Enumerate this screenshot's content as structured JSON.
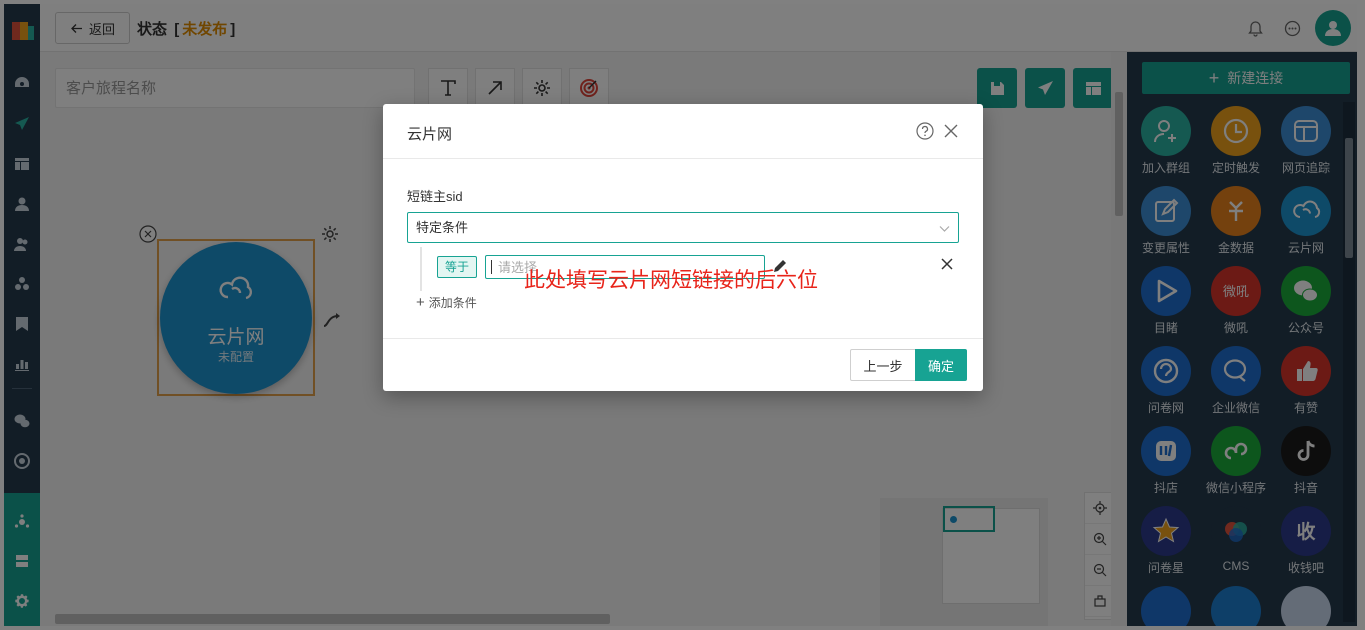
{
  "header": {
    "back_label": "返回",
    "title_prefix": "状态",
    "bracket_open": "[",
    "status": "未发布",
    "bracket_close": "]"
  },
  "canvas": {
    "name_placeholder": "客户旅程名称",
    "node": {
      "label": "云片网",
      "sublabel": "未配置"
    }
  },
  "right_panel": {
    "new_connection_label": "新建连接",
    "tiles": [
      {
        "label": "加入群组",
        "color": "#2bb3a3",
        "icon": "user-add-icon"
      },
      {
        "label": "定时触发",
        "color": "#f0a31c",
        "icon": "clock-icon"
      },
      {
        "label": "网页追踪",
        "color": "#3d8fd6",
        "icon": "webpage-icon"
      },
      {
        "label": "变更属性",
        "color": "#3d8fd6",
        "icon": "edit-icon"
      },
      {
        "label": "金数据",
        "color": "#e8831c",
        "icon": "jinshuju-icon"
      },
      {
        "label": "云片网",
        "color": "#1d94d1",
        "icon": "cloud-icon"
      },
      {
        "label": "目睹",
        "color": "#1f6fd1",
        "icon": "play-icon"
      },
      {
        "label": "微吼",
        "color": "#d9342b",
        "icon": "weihou-icon"
      },
      {
        "label": "公众号",
        "color": "#1aad3b",
        "icon": "wechat-icon"
      },
      {
        "label": "问卷网",
        "color": "#1f6fd1",
        "icon": "wenjuan-icon"
      },
      {
        "label": "企业微信",
        "color": "#1f6fd1",
        "icon": "wecom-icon"
      },
      {
        "label": "有赞",
        "color": "#d9342b",
        "icon": "thumb-up-icon"
      },
      {
        "label": "抖店",
        "color": "#1f6fd1",
        "icon": "doudian-icon"
      },
      {
        "label": "微信小程序",
        "color": "#1aad3b",
        "icon": "mini-program-icon"
      },
      {
        "label": "抖音",
        "color": "#1a1a1a",
        "icon": "tiktok-icon"
      },
      {
        "label": "问卷星",
        "color": "#2d3a8c",
        "icon": "star-icon"
      },
      {
        "label": "CMS",
        "color": "#243a4d",
        "icon": "cms-icon"
      },
      {
        "label": "收钱吧",
        "color": "#2d3a8c",
        "icon": "shouqianba-icon"
      }
    ]
  },
  "modal": {
    "title": "云片网",
    "field_label": "短链主sid",
    "select_value": "特定条件",
    "condition_tag": "等于",
    "condition_placeholder": "请选择",
    "annotation": "此处填写云片网短链接的后六位",
    "add_condition_label": "添加条件",
    "prev_button": "上一步",
    "ok_button": "确定"
  }
}
